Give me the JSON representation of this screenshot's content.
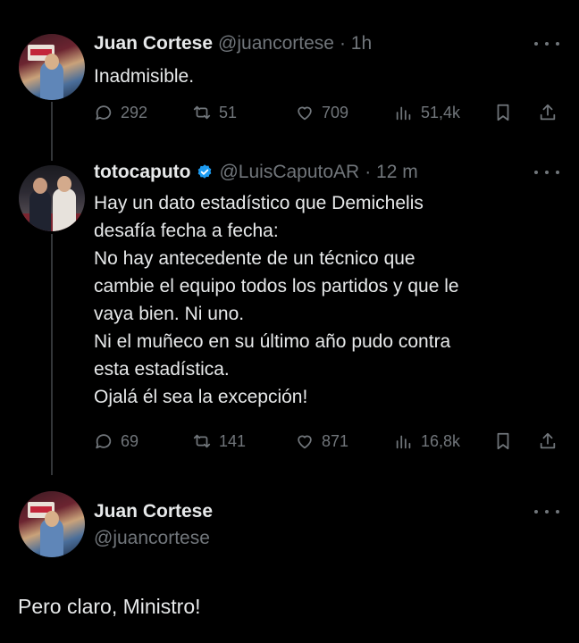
{
  "tweets": [
    {
      "name": "Juan Cortese",
      "handle": "@juancortese",
      "time": "· 1h",
      "text": "Inadmisible.",
      "replies": "292",
      "retweets": "51",
      "likes": "709",
      "views": "51,4k"
    },
    {
      "name": "totocaputo",
      "handle": "@LuisCaputoAR",
      "time": "· 12 m",
      "verified": true,
      "text": "Hay un dato estadístico que Demichelis\ndesafía fecha a fecha:\nNo hay antecedente de un técnico que\ncambie el equipo todos los partidos y que le\nvaya bien. Ni uno.\nNi el muñeco en su último año pudo contra\nesta estadística.\nOjalá él sea la excepción!",
      "replies": "69",
      "retweets": "141",
      "likes": "871",
      "views": "16,8k"
    },
    {
      "name": "Juan Cortese",
      "handle": "@juancortese",
      "text": "Pero claro, Ministro!"
    }
  ],
  "colors": {
    "background": "#000000",
    "text": "#e7e9ea",
    "muted": "#71767b",
    "verified": "#1d9bf0"
  }
}
